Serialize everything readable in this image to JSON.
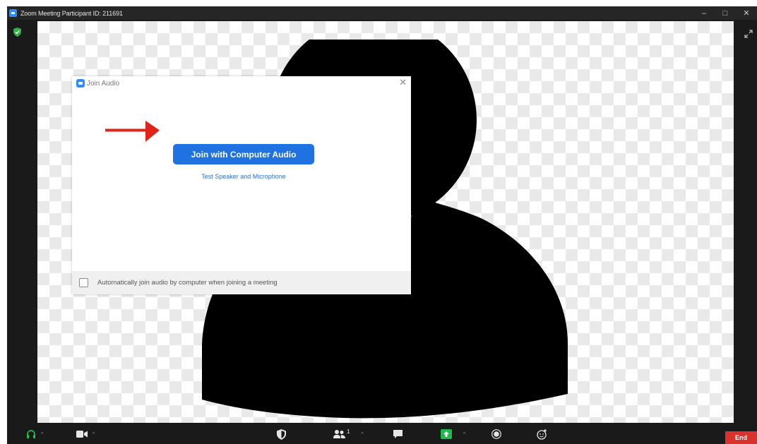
{
  "window": {
    "title": "Zoom Meeting Participant ID: 211691",
    "minimize_glyph": "–",
    "maximize_glyph": "□",
    "close_glyph": "✕"
  },
  "dialog": {
    "title": "Join Audio",
    "close_glyph": "✕",
    "join_button_label": "Join with Computer Audio",
    "test_link_label": "Test Speaker and Microphone",
    "auto_join_label": "Automatically join audio by computer when joining a meeting",
    "auto_join_checked": false
  },
  "toolbar": {
    "participants_count": "1",
    "end_label": "End",
    "caret_glyph": "^"
  },
  "colors": {
    "accent_blue": "#1f72e0",
    "end_red": "#d9322d",
    "arrow_red": "#e2231a",
    "shield_green": "#2fb344",
    "share_green": "#1fb84a"
  },
  "icons": [
    "app-logo-icon",
    "shield-icon",
    "expand-icon",
    "headphone-icon",
    "camera-icon",
    "security-icon",
    "participants-icon",
    "chat-icon",
    "share-screen-icon",
    "record-icon",
    "reactions-icon",
    "close-icon",
    "red-arrow-icon"
  ]
}
